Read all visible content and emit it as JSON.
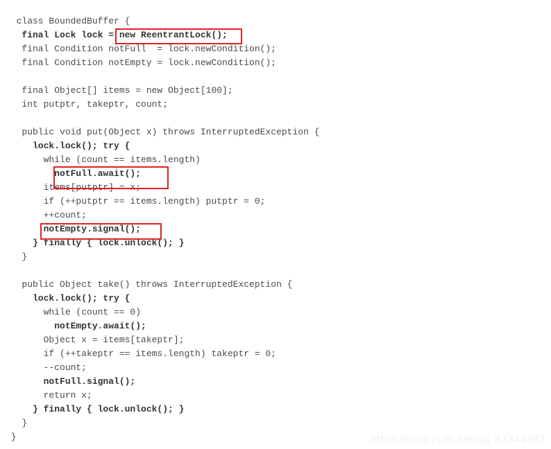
{
  "page": {
    "title": "BoundedBuffer code snippet",
    "background_color": "#ffffff",
    "text_color": "#4a4a4a",
    "bold_text_color": "#333333"
  },
  "code": {
    "language": "java",
    "lines": [
      {
        "text": "class BoundedBuffer {",
        "indent": 2,
        "bold": false
      },
      {
        "text": "final Lock lock = new ReentrantLock();",
        "indent": 3,
        "bold": true
      },
      {
        "text": "final Condition notFull  = lock.newCondition();",
        "indent": 3,
        "bold": false
      },
      {
        "text": "final Condition notEmpty = lock.newCondition();",
        "indent": 3,
        "bold": false
      },
      {
        "text": "",
        "indent": 0,
        "bold": false
      },
      {
        "text": "final Object[] items = new Object[100];",
        "indent": 3,
        "bold": false
      },
      {
        "text": "int putptr, takeptr, count;",
        "indent": 3,
        "bold": false
      },
      {
        "text": "",
        "indent": 0,
        "bold": false
      },
      {
        "text": "public void put(Object x) throws InterruptedException {",
        "indent": 3,
        "bold": false
      },
      {
        "text": "lock.lock(); try {",
        "indent": 5,
        "bold": true
      },
      {
        "text": "while (count == items.length)",
        "indent": 7,
        "bold": false
      },
      {
        "text": "notFull.await();",
        "indent": 9,
        "bold": true
      },
      {
        "text": "items[putptr] = x;",
        "indent": 7,
        "bold": false
      },
      {
        "text": "if (++putptr == items.length) putptr = 0;",
        "indent": 7,
        "bold": false
      },
      {
        "text": "++count;",
        "indent": 7,
        "bold": false
      },
      {
        "text": "notEmpty.signal();",
        "indent": 7,
        "bold": true
      },
      {
        "text": "} finally { lock.unlock(); }",
        "indent": 5,
        "bold": true
      },
      {
        "text": "}",
        "indent": 3,
        "bold": false
      },
      {
        "text": "",
        "indent": 0,
        "bold": false
      },
      {
        "text": "public Object take() throws InterruptedException {",
        "indent": 3,
        "bold": false
      },
      {
        "text": "lock.lock(); try {",
        "indent": 5,
        "bold": true
      },
      {
        "text": "while (count == 0)",
        "indent": 7,
        "bold": false
      },
      {
        "text": "notEmpty.await();",
        "indent": 9,
        "bold": true
      },
      {
        "text": "Object x = items[takeptr];",
        "indent": 7,
        "bold": false
      },
      {
        "text": "if (++takeptr == items.length) takeptr = 0;",
        "indent": 7,
        "bold": false
      },
      {
        "text": "--count;",
        "indent": 7,
        "bold": false
      },
      {
        "text": "notFull.signal();",
        "indent": 7,
        "bold": true
      },
      {
        "text": "return x;",
        "indent": 7,
        "bold": false
      },
      {
        "text": "} finally { lock.unlock(); }",
        "indent": 5,
        "bold": true
      },
      {
        "text": "}",
        "indent": 3,
        "bold": false
      },
      {
        "text": "}",
        "indent": 1,
        "bold": false
      }
    ]
  },
  "annotations": {
    "color": "#e02020",
    "boxes": [
      {
        "id": "hl-box-1",
        "target_text": "= new ReentrantLock();"
      },
      {
        "id": "hl-box-2",
        "target_text": "notFull.await();"
      },
      {
        "id": "hl-box-3",
        "target_text": "notEmpty.signal();"
      }
    ]
  },
  "watermark": {
    "text": "https://blog.csdn.net/qq_43744387",
    "color": "#f0f0f0"
  }
}
